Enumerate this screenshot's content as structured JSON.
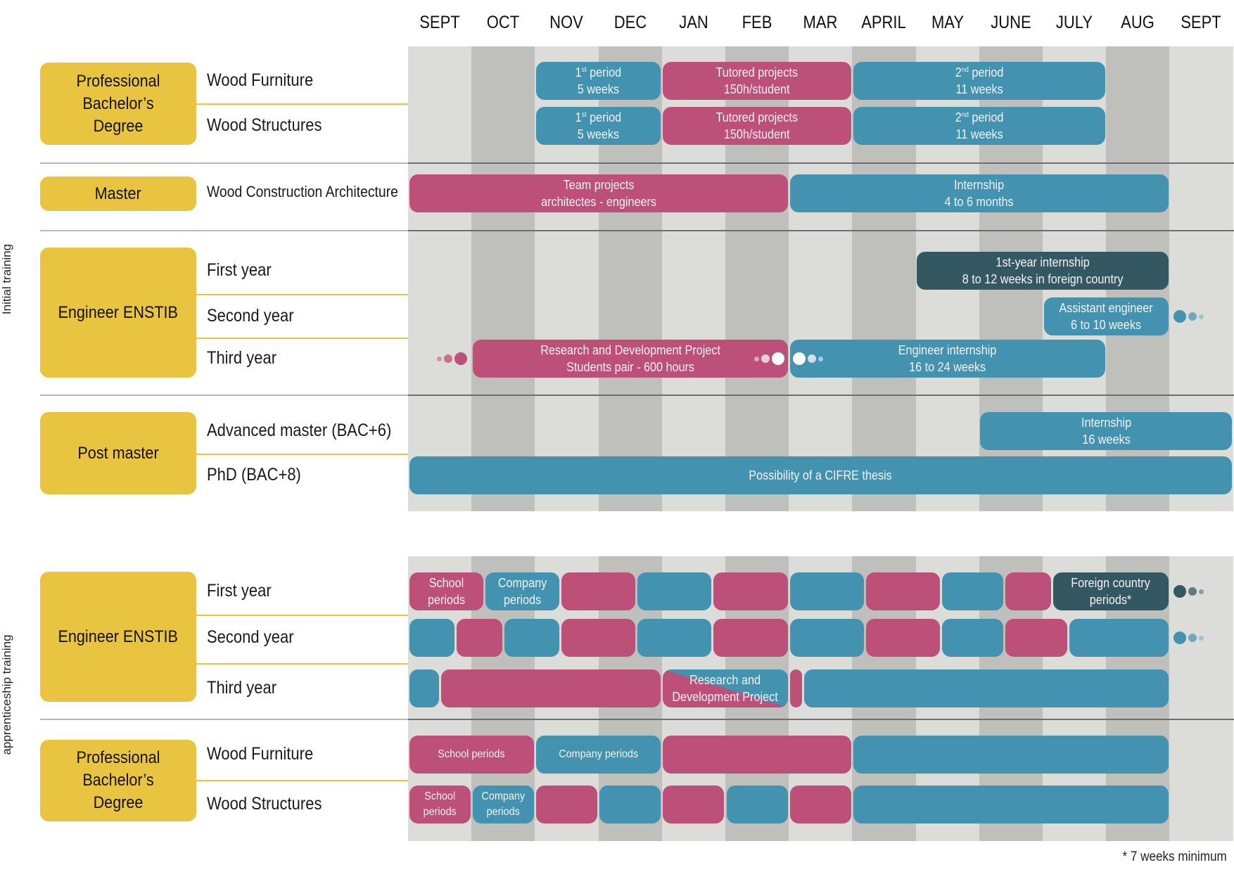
{
  "months": [
    "SEPT",
    "OCT",
    "NOV",
    "DEC",
    "JAN",
    "FEB",
    "MAR",
    "APRIL",
    "MAY",
    "JUNE",
    "JULY",
    "AUG",
    "SEPT"
  ],
  "colors": {
    "school_pink": "#bd5078",
    "company_blue": "#4292b0",
    "foreign_dark_teal": "#345862",
    "degree_yellow": "#e9c441",
    "grid_light": "#dcddd9",
    "grid_dark": "#bfc0bb"
  },
  "sections": [
    {
      "side_label": "Initial training",
      "groups": [
        {
          "degree": "Professional Bachelor’s Degree",
          "rows": [
            {
              "label": "Wood Furniture",
              "bars": [
                {
                  "start": 2,
                  "end": 4,
                  "type": "blue",
                  "line1": "1st period",
                  "sup": "st",
                  "line1_base": "1",
                  "line1_rest": " period",
                  "line2": "5 weeks"
                },
                {
                  "start": 4,
                  "end": 7,
                  "type": "pink",
                  "line1": "Tutored projects",
                  "line2": "150h/student"
                },
                {
                  "start": 7,
                  "end": 11,
                  "type": "blue",
                  "line1": "2nd period",
                  "sup": "nd",
                  "line1_base": "2",
                  "line1_rest": " period",
                  "line2": "11 weeks"
                }
              ]
            },
            {
              "label": "Wood Structures",
              "bars": [
                {
                  "start": 2,
                  "end": 4,
                  "type": "blue",
                  "line1": "1st period",
                  "sup": "st",
                  "line1_base": "1",
                  "line1_rest": " period",
                  "line2": "5 weeks"
                },
                {
                  "start": 4,
                  "end": 7,
                  "type": "pink",
                  "line1": "Tutored projects",
                  "line2": "150h/student"
                },
                {
                  "start": 7,
                  "end": 11,
                  "type": "blue",
                  "line1": "2nd period",
                  "sup": "nd",
                  "line1_base": "2",
                  "line1_rest": " period",
                  "line2": "11 weeks"
                }
              ]
            }
          ]
        },
        {
          "degree": "Master",
          "rows": [
            {
              "label": "Wood Construction Architecture",
              "bars": [
                {
                  "start": 0,
                  "end": 6,
                  "type": "pink",
                  "line1": "Team projects",
                  "line2": "architectes - engineers"
                },
                {
                  "start": 6,
                  "end": 12,
                  "type": "blue",
                  "line1": "Internship",
                  "line2": "4 to 6 months"
                }
              ]
            }
          ]
        },
        {
          "degree": "Engineer ENSTIB",
          "rows": [
            {
              "label": "First year",
              "bars": [
                {
                  "start": 8,
                  "end": 12,
                  "type": "darkteal",
                  "line1": "1st-year internship",
                  "line2": "8 to 12 weeks in foreign country"
                }
              ]
            },
            {
              "label": "Second year",
              "bars": [
                {
                  "start": 10,
                  "end": 12,
                  "type": "blue",
                  "line1": "Assistant engineer",
                  "line2": "6 to 10 weeks"
                }
              ],
              "continues": "blue"
            },
            {
              "label": "Third year",
              "bars": [
                {
                  "start": 1,
                  "end": 6,
                  "type": "pink",
                  "line1": "Research and Development Project",
                  "line2": "Students pair - 600 hours"
                },
                {
                  "start": 6,
                  "end": 11,
                  "type": "blue",
                  "line1": "Engineer internship",
                  "line2": "16 to 24 weeks"
                }
              ],
              "leads_in": "pink"
            }
          ]
        },
        {
          "degree": "Post master",
          "rows": [
            {
              "label": "Advanced master (BAC+6)",
              "bars": [
                {
                  "start": 9,
                  "end": 13,
                  "type": "blue",
                  "line1": "Internship",
                  "line2": "16 weeks"
                }
              ]
            },
            {
              "label": "PhD (BAC+8)",
              "bars": [
                {
                  "start": 0,
                  "end": 13,
                  "type": "blue",
                  "line1": "Possibility of a CIFRE thesis",
                  "line2": ""
                }
              ]
            }
          ]
        }
      ]
    },
    {
      "side_label": "apprenticeship training",
      "groups": [
        {
          "degree": "Engineer ENSTIB",
          "rows": [
            {
              "label": "First year",
              "continues": "darkteal",
              "bars": [
                {
                  "start": 0,
                  "end": 1.2,
                  "type": "pink",
                  "line1": "School",
                  "line2": "periods"
                },
                {
                  "start": 1.2,
                  "end": 2.4,
                  "type": "blue",
                  "line1": "Company",
                  "line2": "periods"
                },
                {
                  "start": 2.4,
                  "end": 3.6,
                  "type": "pink"
                },
                {
                  "start": 3.6,
                  "end": 4.8,
                  "type": "blue"
                },
                {
                  "start": 4.8,
                  "end": 6.0,
                  "type": "pink"
                },
                {
                  "start": 6.0,
                  "end": 7.2,
                  "type": "blue"
                },
                {
                  "start": 7.2,
                  "end": 8.4,
                  "type": "pink"
                },
                {
                  "start": 8.4,
                  "end": 9.4,
                  "type": "blue"
                },
                {
                  "start": 9.4,
                  "end": 10.15,
                  "type": "pink"
                },
                {
                  "start": 10.15,
                  "end": 12,
                  "type": "darkteal",
                  "line1": "Foreign country",
                  "line2": "periods*"
                }
              ]
            },
            {
              "label": "Second year",
              "continues": "blue",
              "bars": [
                {
                  "start": 0,
                  "end": 0.75,
                  "type": "blue"
                },
                {
                  "start": 0.75,
                  "end": 1.5,
                  "type": "pink"
                },
                {
                  "start": 1.5,
                  "end": 2.4,
                  "type": "blue"
                },
                {
                  "start": 2.4,
                  "end": 3.6,
                  "type": "pink"
                },
                {
                  "start": 3.6,
                  "end": 4.8,
                  "type": "blue"
                },
                {
                  "start": 4.8,
                  "end": 6.0,
                  "type": "pink"
                },
                {
                  "start": 6.0,
                  "end": 7.2,
                  "type": "blue"
                },
                {
                  "start": 7.2,
                  "end": 8.4,
                  "type": "pink"
                },
                {
                  "start": 8.4,
                  "end": 9.4,
                  "type": "blue"
                },
                {
                  "start": 9.4,
                  "end": 10.4,
                  "type": "pink"
                },
                {
                  "start": 10.4,
                  "end": 12,
                  "type": "blue"
                }
              ]
            },
            {
              "label": "Third year",
              "bars": [
                {
                  "start": 0,
                  "end": 0.5,
                  "type": "blue"
                },
                {
                  "start": 0.5,
                  "end": 4.0,
                  "type": "pink"
                },
                {
                  "start": 4.0,
                  "end": 6.0,
                  "type": "split",
                  "line1": "Research and",
                  "line2": "Development Project"
                },
                {
                  "start": 6.0,
                  "end": 6.22,
                  "type": "pink"
                },
                {
                  "start": 6.22,
                  "end": 12,
                  "type": "blue"
                }
              ]
            }
          ]
        },
        {
          "degree": "Professional Bachelor’s Degree",
          "rows": [
            {
              "label": "Wood Furniture",
              "bars": [
                {
                  "start": 0,
                  "end": 2,
                  "type": "pink",
                  "line1": "School periods",
                  "line2": "",
                  "small": true
                },
                {
                  "start": 2,
                  "end": 4,
                  "type": "blue",
                  "line1": "Company periods",
                  "line2": "",
                  "small": true
                },
                {
                  "start": 4,
                  "end": 7,
                  "type": "pink"
                },
                {
                  "start": 7,
                  "end": 12,
                  "type": "blue"
                }
              ]
            },
            {
              "label": "Wood Structures",
              "bars": [
                {
                  "start": 0,
                  "end": 1,
                  "type": "pink",
                  "line1": "School",
                  "line2": "periods",
                  "small": true
                },
                {
                  "start": 1,
                  "end": 2,
                  "type": "blue",
                  "line1": "Company",
                  "line2": "periods",
                  "small": true
                },
                {
                  "start": 2,
                  "end": 3,
                  "type": "pink"
                },
                {
                  "start": 3,
                  "end": 4,
                  "type": "blue"
                },
                {
                  "start": 4,
                  "end": 5,
                  "type": "pink"
                },
                {
                  "start": 5,
                  "end": 6,
                  "type": "blue"
                },
                {
                  "start": 6,
                  "end": 7,
                  "type": "pink"
                },
                {
                  "start": 7,
                  "end": 12,
                  "type": "blue"
                }
              ]
            }
          ]
        }
      ]
    }
  ],
  "footnote": "* 7 weeks minimum"
}
